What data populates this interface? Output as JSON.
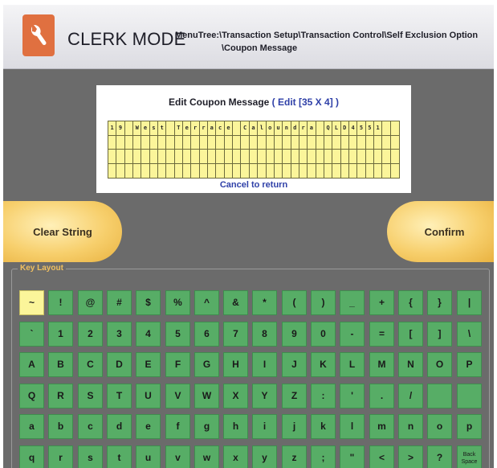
{
  "header": {
    "mode_title": "CLERK MODE",
    "menutree_line1": "MenuTree:\\Transaction Setup\\Transaction Control\\Self  Exclusion Option",
    "menutree_line2": "\\Coupon Message"
  },
  "editor": {
    "title": "Edit Coupon Message",
    "mode": "( Edit [35 X 4] )",
    "columns": 35,
    "rows": 4,
    "row1_text": "19 West Terrace Caloundra QLD4551",
    "cancel_label": "Cancel to return"
  },
  "buttons": {
    "clear_label": "Clear String",
    "confirm_label": "Confirm"
  },
  "keyboard": {
    "label": "Key Layout",
    "selected": "~",
    "rows": [
      [
        "~",
        "!",
        "@",
        "#",
        "$",
        "%",
        "^",
        "&",
        "*",
        "(",
        ")",
        "_",
        "+",
        "{",
        "}",
        "|"
      ],
      [
        "`",
        "1",
        "2",
        "3",
        "4",
        "5",
        "6",
        "7",
        "8",
        "9",
        "0",
        "-",
        "=",
        "[",
        "]",
        "\\"
      ],
      [
        "A",
        "B",
        "C",
        "D",
        "E",
        "F",
        "G",
        "H",
        "I",
        "J",
        "K",
        "L",
        "M",
        "N",
        "O",
        "P"
      ],
      [
        "Q",
        "R",
        "S",
        "T",
        "U",
        "V",
        "W",
        "X",
        "Y",
        "Z",
        ":",
        "'",
        ".",
        "/",
        "",
        ""
      ],
      [
        "a",
        "b",
        "c",
        "d",
        "e",
        "f",
        "g",
        "h",
        "i",
        "j",
        "k",
        "l",
        "m",
        "n",
        "o",
        "p"
      ],
      [
        "q",
        "r",
        "s",
        "t",
        "u",
        "v",
        "w",
        "x",
        "y",
        "z",
        ";",
        "\"",
        "<",
        ">",
        "?",
        "Back Space"
      ]
    ]
  },
  "colors": {
    "key_green": "#57ad66",
    "selected_key": "#fbf59a",
    "accent_blue": "#2f40a8",
    "button_orange": "#f7cf6c",
    "logo_orange": "#e07040"
  }
}
